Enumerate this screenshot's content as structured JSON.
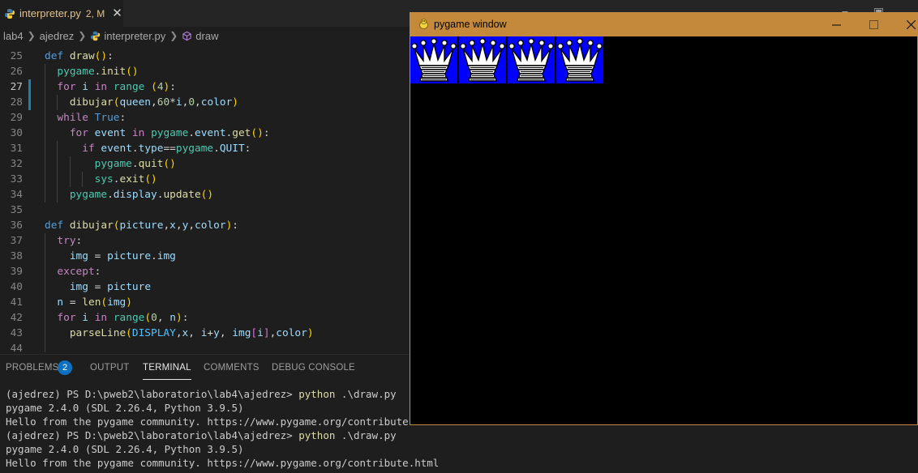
{
  "editor": {
    "tab": {
      "title": "interpreter.py",
      "modified": "2, M"
    },
    "breadcrumb": [
      "lab4",
      "ajedrez",
      "interpreter.py",
      "draw"
    ],
    "active_line": "27"
  },
  "code_lines": [
    {
      "n": "25",
      "html": "<span class=\"kw\">def</span> <span class=\"fn\">draw</span><span class=\"par\">()</span><span class=\"pn\">:</span>"
    },
    {
      "n": "26",
      "html": "  <span class=\"cls\">pygame</span><span class=\"pn\">.</span><span class=\"fn\">init</span><span class=\"par\">()</span>"
    },
    {
      "n": "27",
      "html": "  <span class=\"ctl\">for</span> <span class=\"var\">i</span> <span class=\"ctl\">in</span> <span class=\"cls\">range</span> <span class=\"par\">(</span><span class=\"num\">4</span><span class=\"par\">)</span><span class=\"pn\">:</span>"
    },
    {
      "n": "28",
      "html": "    <span class=\"fn\">dibujar</span><span class=\"par\">(</span><span class=\"var\">queen</span><span class=\"pn\">,</span><span class=\"num\">60</span><span class=\"pn\">*</span><span class=\"var\">i</span><span class=\"pn\">,</span><span class=\"num\">0</span><span class=\"pn\">,</span><span class=\"var\">color</span><span class=\"par\">)</span>"
    },
    {
      "n": "29",
      "html": "  <span class=\"ctl\">while</span> <span class=\"kw\">True</span><span class=\"pn\">:</span>"
    },
    {
      "n": "30",
      "html": "    <span class=\"ctl\">for</span> <span class=\"var\">event</span> <span class=\"ctl\">in</span> <span class=\"cls\">pygame</span><span class=\"pn\">.</span><span class=\"var\">event</span><span class=\"pn\">.</span><span class=\"fn\">get</span><span class=\"par\">()</span><span class=\"pn\">:</span>"
    },
    {
      "n": "31",
      "html": "      <span class=\"ctl\">if</span> <span class=\"var\">event</span><span class=\"pn\">.</span><span class=\"var\">type</span><span class=\"pn\">==</span><span class=\"cls\">pygame</span><span class=\"pn\">.</span><span class=\"var\">QUIT</span><span class=\"pn\">:</span>"
    },
    {
      "n": "32",
      "html": "        <span class=\"cls\">pygame</span><span class=\"pn\">.</span><span class=\"fn\">quit</span><span class=\"par\">()</span>"
    },
    {
      "n": "33",
      "html": "        <span class=\"cls\">sys</span><span class=\"pn\">.</span><span class=\"fn\">exit</span><span class=\"par\">()</span>"
    },
    {
      "n": "34",
      "html": "    <span class=\"cls\">pygame</span><span class=\"pn\">.</span><span class=\"var\">display</span><span class=\"pn\">.</span><span class=\"fn\">update</span><span class=\"par\">()</span>"
    },
    {
      "n": "35",
      "html": ""
    },
    {
      "n": "36",
      "html": "<span class=\"kw\">def</span> <span class=\"fn\">dibujar</span><span class=\"par\">(</span><span class=\"var\">picture</span><span class=\"pn\">,</span><span class=\"var\">x</span><span class=\"pn\">,</span><span class=\"var\">y</span><span class=\"pn\">,</span><span class=\"var\">color</span><span class=\"par\">)</span><span class=\"pn\">:</span>"
    },
    {
      "n": "37",
      "html": "  <span class=\"ctl\">try</span><span class=\"pn\">:</span>"
    },
    {
      "n": "38",
      "html": "    <span class=\"var\">img</span> <span class=\"pn\">=</span> <span class=\"var\">picture</span><span class=\"pn\">.</span><span class=\"var\">img</span>"
    },
    {
      "n": "39",
      "html": "  <span class=\"ctl\">except</span><span class=\"pn\">:</span>"
    },
    {
      "n": "40",
      "html": "    <span class=\"var\">img</span> <span class=\"pn\">=</span> <span class=\"var\">picture</span>"
    },
    {
      "n": "41",
      "html": "  <span class=\"var\">n</span> <span class=\"pn\">=</span> <span class=\"fn\">len</span><span class=\"par\">(</span><span class=\"var\">img</span><span class=\"par\">)</span>"
    },
    {
      "n": "42",
      "html": "  <span class=\"ctl\">for</span> <span class=\"var\">i</span> <span class=\"ctl\">in</span> <span class=\"cls\">range</span><span class=\"par\">(</span><span class=\"num\">0</span><span class=\"pn\">,</span> <span class=\"var\">n</span><span class=\"par\">)</span><span class=\"pn\">:</span>"
    },
    {
      "n": "43",
      "html": "    <span class=\"fn\">parseLine</span><span class=\"par\">(</span><span class=\"cst\">DISPLAY</span><span class=\"pn\">,</span><span class=\"var\">x</span><span class=\"pn\">,</span> <span class=\"var\">i</span><span class=\"pn\">+</span><span class=\"var\">y</span><span class=\"pn\">,</span> <span class=\"var\">img</span><span class=\"par2\">[</span><span class=\"var\">i</span><span class=\"par2\">]</span><span class=\"pn\">,</span><span class=\"var\">color</span><span class=\"par\">)</span>"
    },
    {
      "n": "44",
      "html": ""
    }
  ],
  "panel": {
    "tabs": [
      "PROBLEMS",
      "OUTPUT",
      "TERMINAL",
      "COMMENTS",
      "DEBUG CONSOLE"
    ],
    "active_tab": "TERMINAL",
    "problems_count": "2"
  },
  "terminal": [
    {
      "prompt": "(ajedrez) PS D:\\pweb2\\laboratorio\\lab4\\ajedrez> ",
      "cmd": "python",
      "args": " .\\draw.py"
    },
    {
      "text": "pygame 2.4.0 (SDL 2.26.4, Python 3.9.5)"
    },
    {
      "text": "Hello from the pygame community. https://www.pygame.org/contribute.html"
    },
    {
      "prompt": "(ajedrez) PS D:\\pweb2\\laboratorio\\lab4\\ajedrez> ",
      "cmd": "python",
      "args": " .\\draw.py"
    },
    {
      "text": "pygame 2.4.0 (SDL 2.26.4, Python 3.9.5)"
    },
    {
      "text": "Hello from the pygame community. https://www.pygame.org/contribute.html"
    }
  ],
  "pygame_window": {
    "title": "pygame window",
    "queen_count": 4,
    "colors": {
      "tile": "#0000ff",
      "background": "#000000",
      "titlebar": "#c4893b"
    }
  },
  "icons": [
    "python-file-icon",
    "close-icon",
    "symbol-method-icon",
    "pygame-icon",
    "minimize-icon",
    "maximize-icon",
    "window-close-icon",
    "queen-icon"
  ]
}
